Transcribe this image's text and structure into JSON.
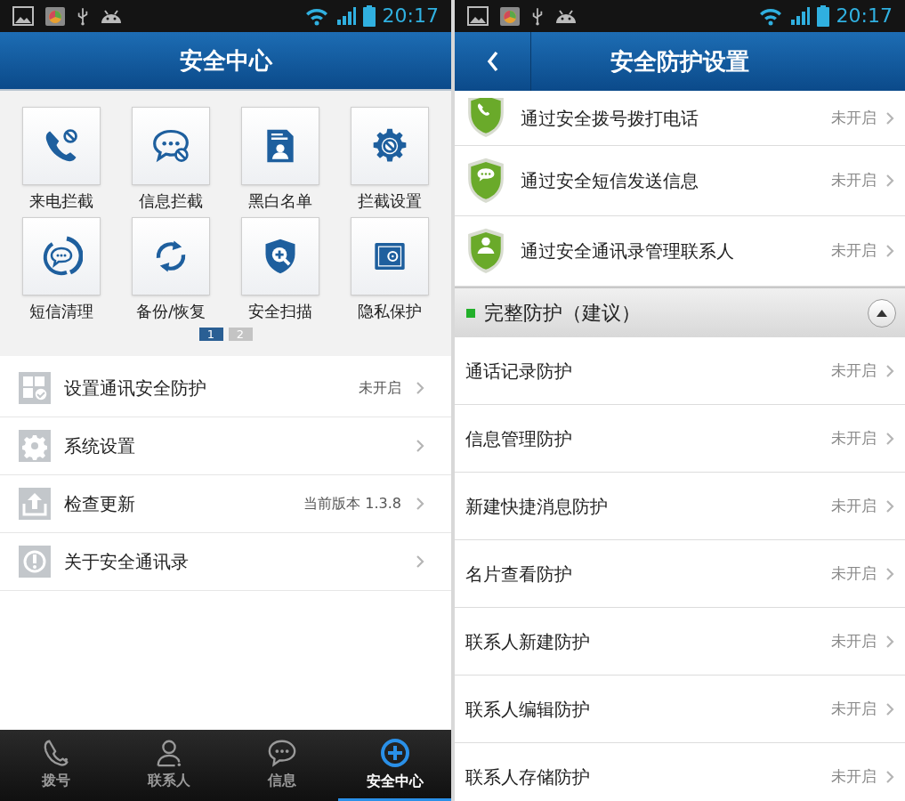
{
  "left": {
    "status_bar": {
      "time": "20:17"
    },
    "title": "安全中心",
    "tiles": [
      {
        "label": "来电拦截"
      },
      {
        "label": "信息拦截"
      },
      {
        "label": "黑白名单"
      },
      {
        "label": "拦截设置"
      },
      {
        "label": "短信清理"
      },
      {
        "label": "备份/恢复"
      },
      {
        "label": "安全扫描"
      },
      {
        "label": "隐私保护"
      }
    ],
    "pager": [
      {
        "label": "1",
        "selected": true
      },
      {
        "label": "2",
        "selected": false
      }
    ],
    "menu": [
      {
        "label": "设置通讯安全防护",
        "value": "未开启"
      },
      {
        "label": "系统设置"
      },
      {
        "label": "检查更新",
        "value": "当前版本 1.3.8"
      },
      {
        "label": "关于安全通讯录"
      }
    ],
    "tabs": [
      {
        "label": "拨号",
        "selected": false
      },
      {
        "label": "联系人",
        "selected": false
      },
      {
        "label": "信息",
        "selected": false
      },
      {
        "label": "安全中心",
        "selected": true
      }
    ]
  },
  "right": {
    "status_bar": {
      "time": "20:17"
    },
    "title": "安全防护设置",
    "basic_items": [
      {
        "label": "通过安全拨号拨打电话",
        "status": "未开启"
      },
      {
        "label": "通过安全短信发送信息",
        "status": "未开启"
      },
      {
        "label": "通过安全通讯录管理联系人",
        "status": "未开启"
      }
    ],
    "section": {
      "label": "完整防护（建议）",
      "expanded": true
    },
    "items": [
      {
        "label": "通话记录防护",
        "status": "未开启"
      },
      {
        "label": "信息管理防护",
        "status": "未开启"
      },
      {
        "label": "新建快捷消息防护",
        "status": "未开启"
      },
      {
        "label": "名片查看防护",
        "status": "未开启"
      },
      {
        "label": "联系人新建防护",
        "status": "未开启"
      },
      {
        "label": "联系人编辑防护",
        "status": "未开启"
      },
      {
        "label": "联系人存储防护",
        "status": "未开启"
      }
    ]
  }
}
